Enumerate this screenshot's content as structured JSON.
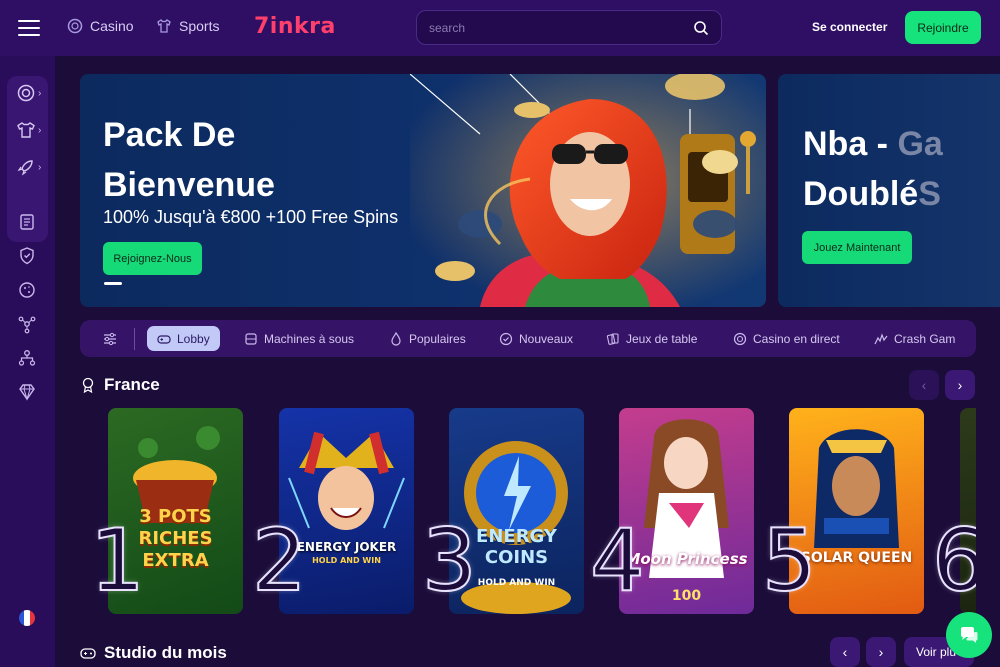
{
  "topbar": {
    "nav": [
      {
        "label": "Casino",
        "icon": "casino-chip-icon"
      },
      {
        "label": "Sports",
        "icon": "jersey-icon"
      }
    ],
    "logo": "7inkra",
    "search_placeholder": "search",
    "connect_label": "Se connecter",
    "join_label": "Rejoindre"
  },
  "sidebar": {
    "group_icons": [
      "lifebuoy-icon",
      "jersey-icon",
      "rocket-icon"
    ],
    "icons": [
      "document-icon",
      "shield-icon",
      "cookie-icon",
      "network-icon",
      "hierarchy-icon",
      "diamond-icon"
    ],
    "language": "fr"
  },
  "banners": [
    {
      "title": "Pack De Bienvenue",
      "subtitle": "100% Jusqu'à €800 +100 Free Spins",
      "button": "Rejoignez-Nous"
    },
    {
      "title_a": "Nba - ",
      "title_fade": "Ga",
      "title_b": "Doublé",
      "title_b_fade": "S",
      "button": "Jouez Maintenant"
    }
  ],
  "categories": [
    {
      "label": "Lobby",
      "icon": "gamepad-icon",
      "active": true
    },
    {
      "label": "Machines à sous",
      "icon": "slot-icon",
      "active": false
    },
    {
      "label": "Populaires",
      "icon": "flame-icon",
      "active": false
    },
    {
      "label": "Nouveaux",
      "icon": "badge-check-icon",
      "active": false
    },
    {
      "label": "Jeux de table",
      "icon": "cards-icon",
      "active": false
    },
    {
      "label": "Casino en direct",
      "icon": "live-chip-icon",
      "active": false
    },
    {
      "label": "Crash Gam",
      "icon": "crash-icon",
      "active": false
    }
  ],
  "section_france": {
    "title": "France"
  },
  "games": [
    {
      "rank": "1",
      "name": "3 POTS RICHES EXTRA"
    },
    {
      "rank": "2",
      "name": "ENERGY JOKER",
      "tag": "HOLD AND WIN"
    },
    {
      "rank": "3",
      "name": "ENERGY COINS",
      "tag": "HOLD AND WIN"
    },
    {
      "rank": "4",
      "name": "Moon Princess",
      "tag": "100"
    },
    {
      "rank": "5",
      "name": "SOLAR QUEEN"
    },
    {
      "rank": "6",
      "name": ""
    }
  ],
  "section_studio": {
    "title": "Studio du mois",
    "voir_label": "Voir plu"
  },
  "colors": {
    "bg": "#1b0c3a",
    "topbar": "#2e0f63",
    "accent": "#17e37c",
    "logo": "#ff3f6c"
  }
}
